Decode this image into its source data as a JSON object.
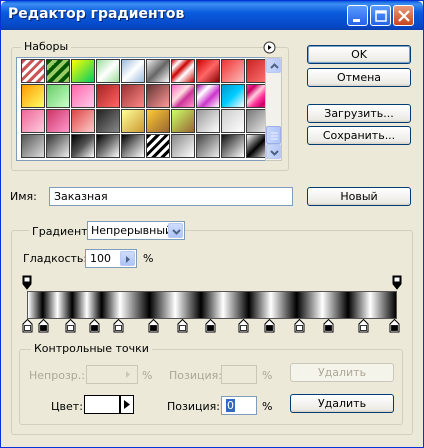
{
  "window": {
    "title": "Редактор градиентов"
  },
  "presets": {
    "label": "Наборы",
    "menu_icon": "circle-arrow-icon",
    "swatches": [
      "linear-gradient(135deg,#c55 0 10%,#fff 10% 20%,#c55 20% 30%,#fff 30% 40%,#c55 40% 50%,#fff 50% 60%,#c55 60% 70%,#fff 70% 80%,#c55 80% 90%,#fff 90%)",
      "linear-gradient(135deg,#050 0 12%,#9c6 12% 25%,#050 25% 37%,#9c6 37% 50%,#050 50% 62%,#9c6 62% 75%,#050 75% 87%,#9c6 87%)",
      "linear-gradient(135deg,#ff0,#0c6)",
      "linear-gradient(135deg,#9d9,#fff 50%,#9d9)",
      "linear-gradient(135deg,#9bd,#fff,#9bd)",
      "linear-gradient(135deg,#eee,#666,#fff)",
      "linear-gradient(135deg,#c00,#fff 20%,#c00 40%,#fff 60%,#c00)",
      "linear-gradient(135deg,#c00,#f66,#800)",
      "linear-gradient(135deg,#e33,#fbb)",
      "linear-gradient(135deg,#c22,#f77)",
      "linear-gradient(135deg,#f90,#ff6)",
      "linear-gradient(135deg,#6c6,#cfc)",
      "linear-gradient(135deg,#f6a,#fce)",
      "linear-gradient(135deg,#a22,#f66)",
      "linear-gradient(135deg,#933,#f88)",
      "linear-gradient(135deg,#633,#f99)",
      "linear-gradient(135deg,#f6c,#fdd 40%,#c39 60%,#f9c)",
      "linear-gradient(135deg,#a0a,#fff 30%,#c3c 60%,#fff)",
      "linear-gradient(135deg,#09c,#0cf,#fff)",
      "linear-gradient(135deg,#f39,#c06 20%,#fcd 40%,#f39 60%,#c06 80%,#f39)",
      "linear-gradient(135deg,#e69,#fcd)",
      "linear-gradient(135deg,#c36,#f9c)",
      "linear-gradient(135deg,#d44,#fcc)",
      "linear-gradient(135deg,#222,#888)",
      "linear-gradient(135deg,#ff9,#c93)",
      "linear-gradient(135deg,#fc3,#963)",
      "linear-gradient(135deg,#cf6,#963)",
      "linear-gradient(135deg,#999,#fff)",
      "linear-gradient(135deg,#ccc,#fff)",
      "linear-gradient(135deg,#777,#eee)",
      "linear-gradient(135deg,#555,#ddd)",
      "linear-gradient(135deg,#333,#eee)",
      "linear-gradient(135deg,#000,#555,#fff)",
      "linear-gradient(135deg,#000,#777,#fff)",
      "linear-gradient(135deg,#000,#888,#fff)",
      "linear-gradient(135deg,#000 0 10%,#fff 10% 20%,#000 20% 30%,#fff 30% 40%,#000 40% 50%,#fff 50% 60%,#000 60% 70%,#fff 70% 80%,#000 80% 90%,#fff 90%)",
      "linear-gradient(135deg,#888,#fff)",
      "linear-gradient(135deg,#444,#eee)",
      "linear-gradient(135deg,#111,#888,#fff)",
      "linear-gradient(135deg,#fff,#000 50%,#fff)"
    ]
  },
  "buttons": {
    "ok": "OK",
    "cancel": "Отмена",
    "load": "Загрузить...",
    "save": "Сохранить...",
    "new": "Новый",
    "delete_opacity": "Удалить",
    "delete_color": "Удалить"
  },
  "name": {
    "label": "Имя:",
    "value": "Заказная"
  },
  "gradient": {
    "type_label": "Градиент:",
    "type_value": "Непрерывный"
  },
  "smoothness": {
    "label": "Гладкость:",
    "value": "100",
    "unit": "%"
  },
  "stops": {
    "group_label": "Контрольные точки",
    "opacity_label": "Непрозр.:",
    "opacity_unit": "%",
    "opacity_position_label": "Позиция:",
    "opacity_position_unit": "%",
    "color_label": "Цвет:",
    "color_position_label": "Позиция:",
    "color_position_value": "0",
    "color_position_unit": "%"
  },
  "colors": {
    "accent": "#0a5bdd",
    "face": "#ece9d8"
  }
}
